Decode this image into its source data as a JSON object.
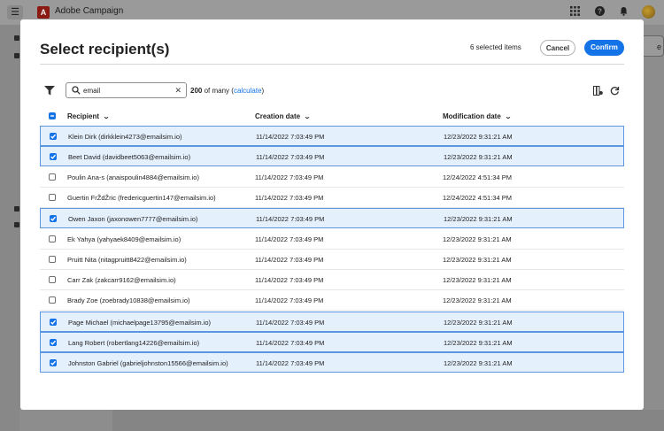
{
  "app": {
    "title": "Adobe Campaign",
    "logo_letter": "A",
    "right_partial_button": "e"
  },
  "dialog": {
    "title": "Select recipient(s)",
    "selected_count": "6 selected items",
    "cancel_label": "Cancel",
    "confirm_label": "Confirm"
  },
  "toolbar": {
    "search_value": "email",
    "count_number": "200",
    "count_text": " of many (",
    "calculate_label": "calculate",
    "count_close": ")"
  },
  "table": {
    "columns": [
      "Recipient",
      "Creation date",
      "Modification date"
    ],
    "rows": [
      {
        "selected": true,
        "recipient": "Klein Dirk (dirkklein4273@emailsim.io)",
        "created": "11/14/2022 7:03:49 PM",
        "modified": "12/23/2022 9:31:21 AM"
      },
      {
        "selected": true,
        "recipient": "Beet David (davidbeet5063@emailsim.io)",
        "created": "11/14/2022 7:03:49 PM",
        "modified": "12/23/2022 9:31:21 AM"
      },
      {
        "selected": false,
        "recipient": "Poulin Ana-s (anaispoulin4884@emailsim.io)",
        "created": "11/14/2022 7:03:49 PM",
        "modified": "12/24/2022 4:51:34 PM"
      },
      {
        "selected": false,
        "recipient": "Guertin FrŽdŽric (fredericguertin147@emailsim.io)",
        "created": "11/14/2022 7:03:49 PM",
        "modified": "12/24/2022 4:51:34 PM"
      },
      {
        "selected": true,
        "recipient": "Owen Jaxon (jaxonowen7777@emailsim.io)",
        "created": "11/14/2022 7:03:49 PM",
        "modified": "12/23/2022 9:31:21 AM"
      },
      {
        "selected": false,
        "recipient": "Ek Yahya (yahyaek8409@emailsim.io)",
        "created": "11/14/2022 7:03:49 PM",
        "modified": "12/23/2022 9:31:21 AM"
      },
      {
        "selected": false,
        "recipient": "Pruitt Nita (nitagpruitt8422@emailsim.io)",
        "created": "11/14/2022 7:03:49 PM",
        "modified": "12/23/2022 9:31:21 AM"
      },
      {
        "selected": false,
        "recipient": "Carr Zak (zakcarr9162@emailsim.io)",
        "created": "11/14/2022 7:03:49 PM",
        "modified": "12/23/2022 9:31:21 AM"
      },
      {
        "selected": false,
        "recipient": "Brady Zoe (zoebrady10838@emailsim.io)",
        "created": "11/14/2022 7:03:49 PM",
        "modified": "12/23/2022 9:31:21 AM"
      },
      {
        "selected": true,
        "recipient": "Page Michael (michaelpage13795@emailsim.io)",
        "created": "11/14/2022 7:03:49 PM",
        "modified": "12/23/2022 9:31:21 AM"
      },
      {
        "selected": true,
        "recipient": "Lang Robert (robertlang14226@emailsim.io)",
        "created": "11/14/2022 7:03:49 PM",
        "modified": "12/23/2022 9:31:21 AM"
      },
      {
        "selected": true,
        "recipient": "Johnston Gabriel (gabrieljohnston15566@emailsim.io)",
        "created": "11/14/2022 7:03:49 PM",
        "modified": "12/23/2022 9:31:21 AM"
      }
    ]
  },
  "colors": {
    "accent": "#1473e6",
    "selected_row_bg": "#e5f0fd",
    "selected_row_border": "#5c96e0"
  },
  "icons": [
    "menu-icon",
    "adobe-logo-icon",
    "apps-grid-icon",
    "help-icon",
    "bell-icon",
    "avatar",
    "filter-icon",
    "search-icon",
    "clear-icon",
    "column-settings-icon",
    "refresh-icon",
    "chevron-down-icon",
    "checkbox"
  ]
}
